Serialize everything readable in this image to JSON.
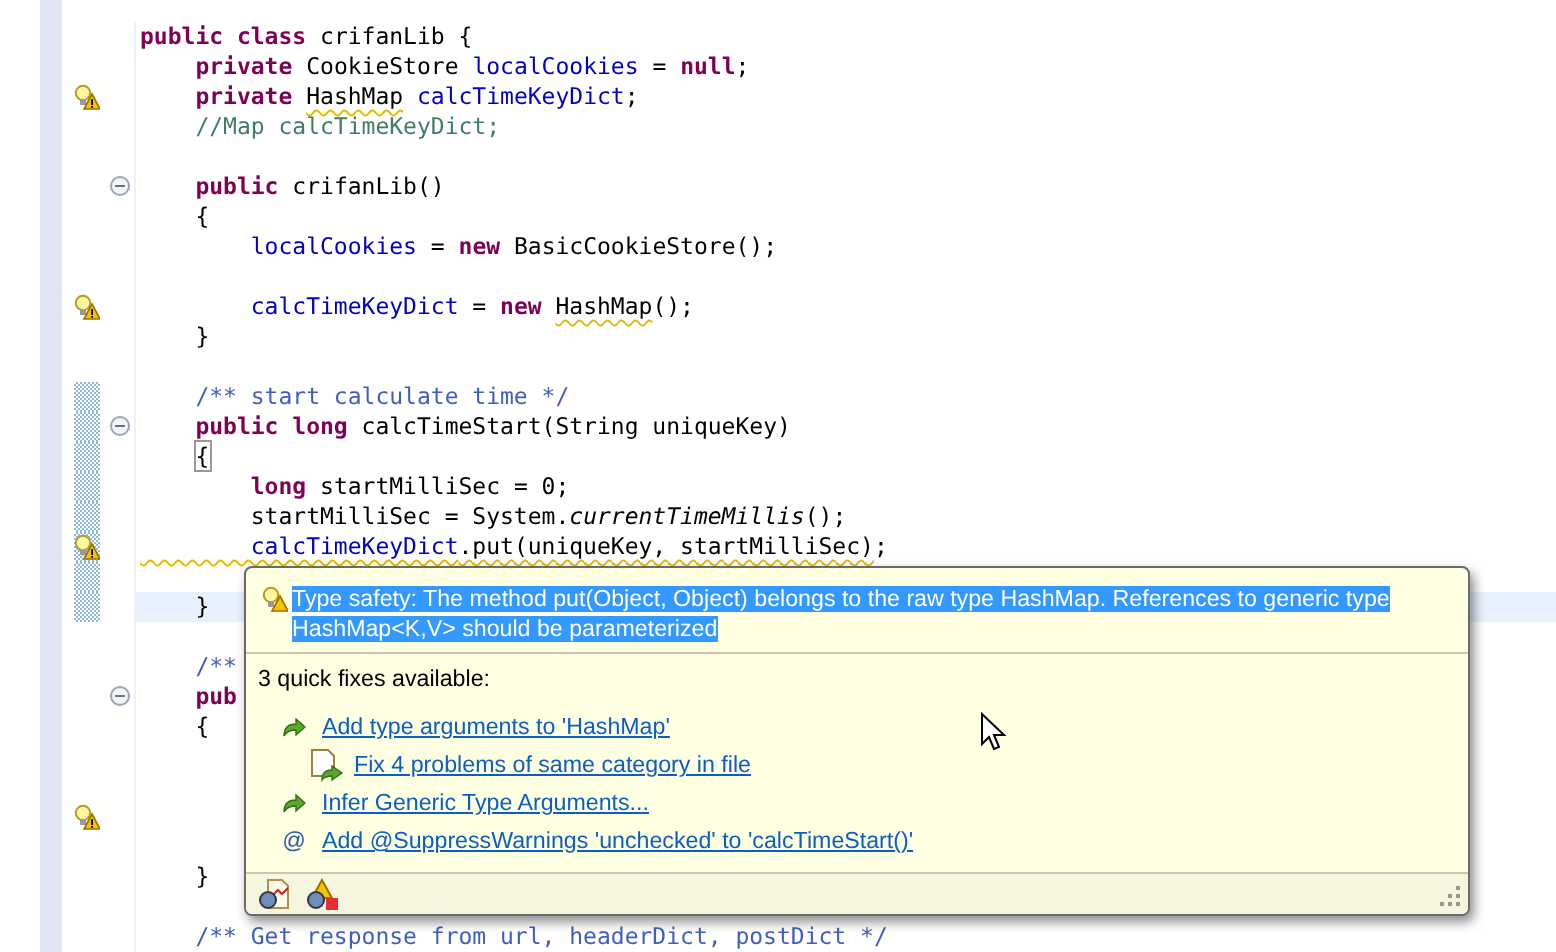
{
  "editor": {
    "lines": [
      {
        "warning": false,
        "fold": false,
        "range": false,
        "current": false,
        "tokens": [
          {
            "kind": "kw",
            "text": "public class"
          },
          {
            "kind": "plain",
            "text": " crifanLib {"
          }
        ]
      },
      {
        "warning": false,
        "fold": false,
        "range": false,
        "current": false,
        "tokens": [
          {
            "kind": "kw",
            "text": "    private"
          },
          {
            "kind": "plain",
            "text": " CookieStore "
          },
          {
            "kind": "field",
            "text": "localCookies"
          },
          {
            "kind": "plain",
            "text": " = "
          },
          {
            "kind": "kw",
            "text": "null"
          },
          {
            "kind": "plain",
            "text": ";"
          }
        ]
      },
      {
        "warning": true,
        "fold": false,
        "range": false,
        "current": false,
        "tokens": [
          {
            "kind": "kw",
            "text": "    private "
          },
          {
            "kind": "warn",
            "text": "HashMap"
          },
          {
            "kind": "field",
            "text": " calcTimeKeyDict"
          },
          {
            "kind": "plain",
            "text": ";"
          }
        ]
      },
      {
        "warning": false,
        "fold": false,
        "range": false,
        "current": false,
        "tokens": [
          {
            "kind": "comment",
            "text": "    //Map calcTimeKeyDict;"
          }
        ]
      },
      {
        "warning": false,
        "fold": false,
        "range": false,
        "current": false
      },
      {
        "warning": false,
        "fold": true,
        "range": false,
        "current": false,
        "tokens": [
          {
            "kind": "kw",
            "text": "    public"
          },
          {
            "kind": "plain",
            "text": " crifanLib()"
          }
        ]
      },
      {
        "warning": false,
        "fold": false,
        "range": false,
        "current": false,
        "tokens": [
          {
            "kind": "plain",
            "text": "    {"
          }
        ]
      },
      {
        "warning": false,
        "fold": false,
        "range": false,
        "current": false,
        "tokens": [
          {
            "kind": "field",
            "text": "        localCookies"
          },
          {
            "kind": "plain",
            "text": " = "
          },
          {
            "kind": "kw",
            "text": "new"
          },
          {
            "kind": "plain",
            "text": " BasicCookieStore();"
          }
        ]
      },
      {
        "warning": false,
        "fold": false,
        "range": false,
        "current": false
      },
      {
        "warning": true,
        "fold": false,
        "range": false,
        "current": false,
        "tokens": [
          {
            "kind": "field",
            "text": "        calcTimeKeyDict"
          },
          {
            "kind": "plain",
            "text": " = "
          },
          {
            "kind": "kw",
            "text": "new "
          },
          {
            "kind": "warn",
            "text": "HashMap"
          },
          {
            "kind": "plain",
            "text": "();"
          }
        ]
      },
      {
        "warning": false,
        "fold": false,
        "range": false,
        "current": false,
        "tokens": [
          {
            "kind": "plain",
            "text": "    }"
          }
        ]
      },
      {
        "warning": false,
        "fold": false,
        "range": false,
        "current": false
      },
      {
        "warning": false,
        "fold": false,
        "range": true,
        "current": false,
        "tokens": [
          {
            "kind": "doc",
            "text": "    /** start calculate time */"
          }
        ]
      },
      {
        "warning": false,
        "fold": true,
        "range": true,
        "current": false,
        "tokens": [
          {
            "kind": "kw",
            "text": "    public long"
          },
          {
            "kind": "plain",
            "text": " calcTimeStart(String uniqueKey)"
          }
        ]
      },
      {
        "warning": false,
        "fold": false,
        "range": true,
        "current": false,
        "tokens": [
          {
            "kind": "match",
            "text": "    {"
          }
        ]
      },
      {
        "warning": false,
        "fold": false,
        "range": true,
        "current": false,
        "tokens": [
          {
            "kind": "kw",
            "text": "        long"
          },
          {
            "kind": "plain",
            "text": " startMilliSec = 0;"
          }
        ]
      },
      {
        "warning": false,
        "fold": false,
        "range": true,
        "current": false,
        "tokens": [
          {
            "kind": "plain",
            "text": "        startMilliSec = System."
          },
          {
            "kind": "static",
            "text": "currentTimeMillis"
          },
          {
            "kind": "plain",
            "text": "();"
          }
        ]
      },
      {
        "warning": true,
        "fold": false,
        "range": true,
        "current": false,
        "tokens": [
          {
            "kind": "field-warn",
            "text": "        calcTimeKeyDict"
          },
          {
            "kind": "warn",
            "text": ".put(uniqueKey, startMilliSec)"
          },
          {
            "kind": "plain",
            "text": ";"
          }
        ]
      },
      {
        "warning": false,
        "fold": false,
        "range": true,
        "current": false
      },
      {
        "warning": false,
        "fold": false,
        "range": true,
        "current": true,
        "tokens": [
          {
            "kind": "plain",
            "text": "    }"
          }
        ]
      },
      {
        "warning": false,
        "fold": false,
        "range": false,
        "current": false
      },
      {
        "warning": false,
        "fold": false,
        "range": false,
        "current": false,
        "tokens": [
          {
            "kind": "doc",
            "text": "    /**"
          }
        ]
      },
      {
        "warning": false,
        "fold": true,
        "range": false,
        "current": false,
        "tokens": [
          {
            "kind": "kw",
            "text": "    pub"
          }
        ]
      },
      {
        "warning": false,
        "fold": false,
        "range": false,
        "current": false,
        "tokens": [
          {
            "kind": "plain",
            "text": "    {"
          }
        ]
      },
      {
        "warning": false,
        "fold": false,
        "range": false,
        "current": false
      },
      {
        "warning": false,
        "fold": false,
        "range": false,
        "current": false
      },
      {
        "warning": true,
        "fold": false,
        "range": false,
        "current": false
      },
      {
        "warning": false,
        "fold": false,
        "range": false,
        "current": false
      },
      {
        "warning": false,
        "fold": false,
        "range": false,
        "current": false,
        "tokens": [
          {
            "kind": "plain",
            "text": "    }"
          }
        ]
      },
      {
        "warning": false,
        "fold": false,
        "range": false,
        "current": false
      },
      {
        "warning": false,
        "fold": false,
        "range": false,
        "current": false,
        "tokens": [
          {
            "kind": "doc",
            "text": "    /** Get response from url, headerDict, postDict */"
          }
        ]
      }
    ]
  },
  "quick_fix_popup": {
    "problem": "Type safety: The method put(Object, Object) belongs to the raw type HashMap. References to generic type HashMap<K,V> should be parameterized",
    "heading": "3 quick fixes available:",
    "fixes": [
      {
        "kind": "change",
        "label": "Add type arguments to 'HashMap'",
        "children": [
          {
            "kind": "multi",
            "label": "Fix 4 problems of same category in file"
          }
        ]
      },
      {
        "kind": "change",
        "label": "Infer Generic Type Arguments..."
      },
      {
        "kind": "annotation",
        "symbol": "@",
        "label": "Add @SuppressWarnings 'unchecked' to 'calcTimeStart()'"
      }
    ]
  }
}
